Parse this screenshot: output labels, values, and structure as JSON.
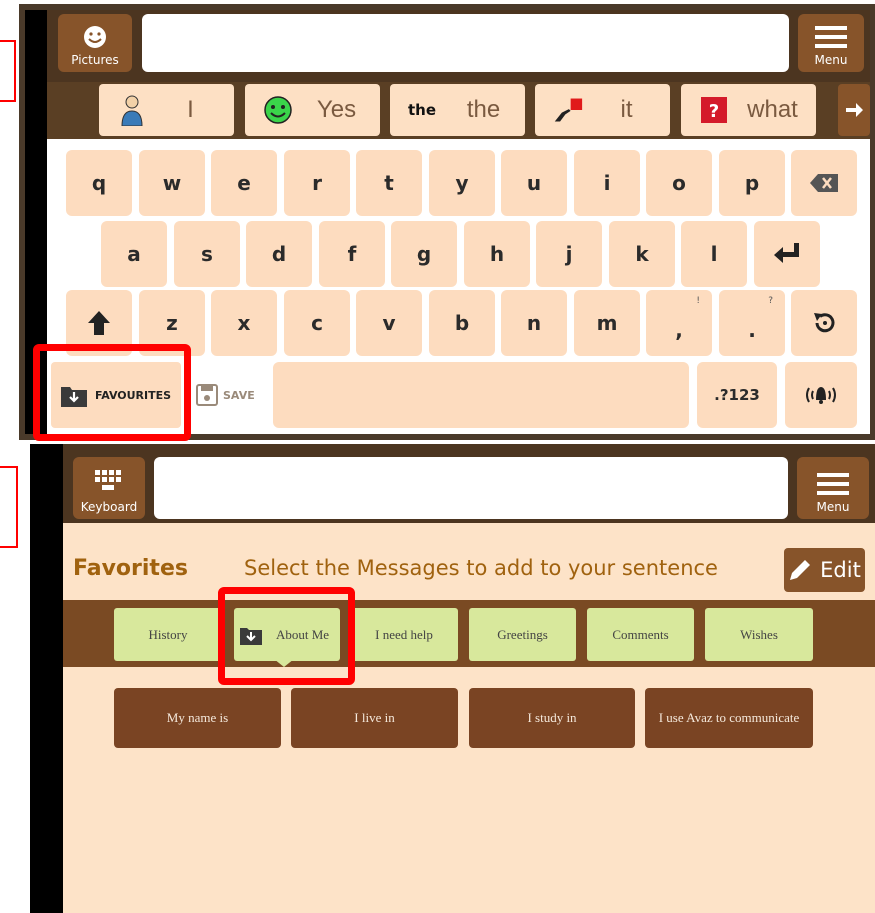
{
  "keyboard_screen": {
    "pictures_label": "Pictures",
    "menu_label": "Menu",
    "word_suggestions": [
      {
        "text": "I",
        "icon": "person-icon"
      },
      {
        "text": "Yes",
        "icon": "smiley-icon"
      },
      {
        "text": "the",
        "icon_text": "the"
      },
      {
        "text": "it",
        "icon": "pointing-hand-icon"
      },
      {
        "text": "what",
        "icon": "question-icon"
      }
    ],
    "rows": [
      [
        "q",
        "w",
        "e",
        "r",
        "t",
        "y",
        "u",
        "i",
        "o",
        "p"
      ],
      [
        "a",
        "s",
        "d",
        "f",
        "g",
        "h",
        "j",
        "k",
        "l"
      ],
      [
        "z",
        "x",
        "c",
        "v",
        "b",
        "n",
        "m",
        ",",
        "."
      ]
    ],
    "comma_alt": "!",
    "period_alt": "?",
    "favourites_label": "FAVOURITES",
    "save_label": "SAVE",
    "numbers_label": ".?123"
  },
  "favorites_screen": {
    "keyboard_label": "Keyboard",
    "menu_label": "Menu",
    "title": "Favorites",
    "subtitle": "Select the Messages to add to your sentence",
    "edit_label": "Edit",
    "categories": [
      "History",
      "About Me",
      "I need help",
      "Greetings",
      "Comments",
      "Wishes"
    ],
    "messages": [
      "My name is",
      "I live in",
      "I study in",
      "I use Avaz to communicate"
    ]
  },
  "colors": {
    "highlight": "#ff0000",
    "key_bg": "#fddcbf",
    "toolbar_brown": "#4c3520",
    "category_green": "#d8e89c",
    "message_brown": "#7a4423"
  }
}
